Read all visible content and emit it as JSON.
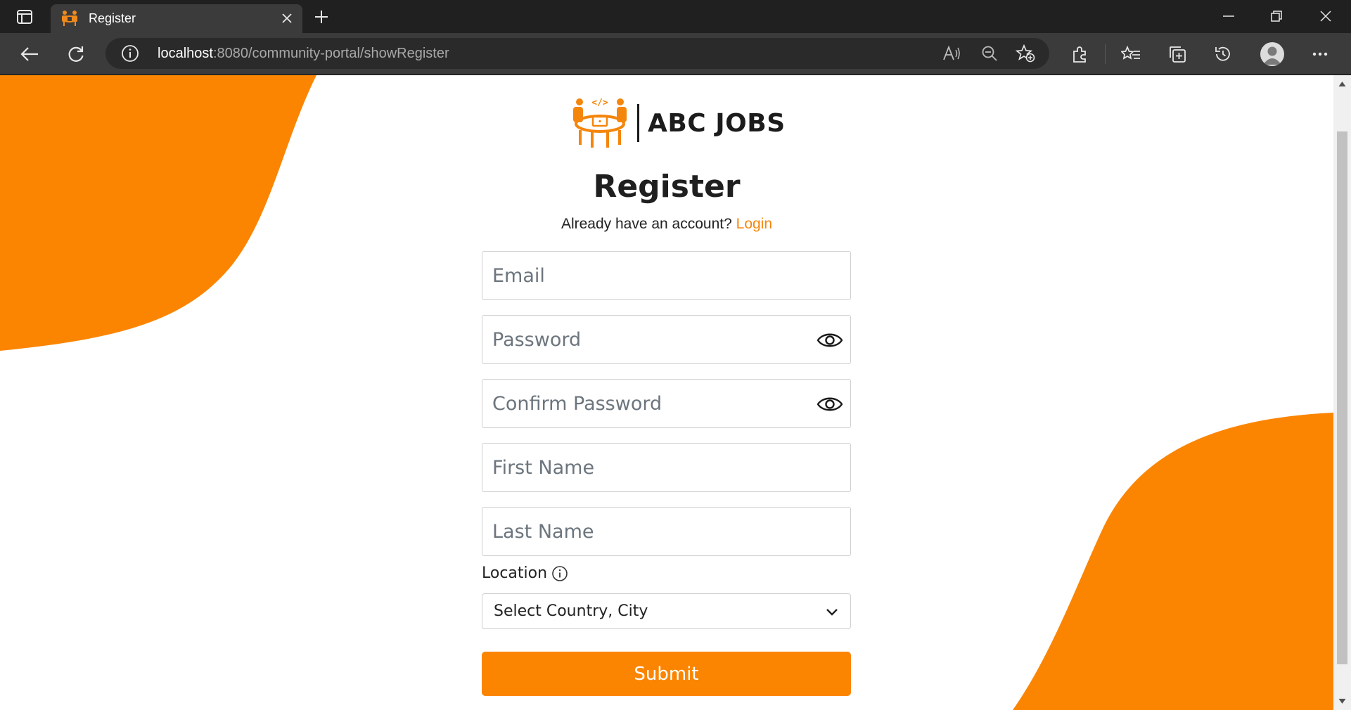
{
  "browser": {
    "tab_title": "Register",
    "url_host": "localhost",
    "url_rest": ":8080/community-portal/showRegister"
  },
  "page": {
    "logo_text": "ABC JOBS",
    "title": "Register",
    "login_prompt": "Already have an account?",
    "login_link": "Login",
    "fields": {
      "email_placeholder": "Email",
      "password_placeholder": "Password",
      "confirm_password_placeholder": "Confirm Password",
      "first_name_placeholder": "First Name",
      "last_name_placeholder": "Last Name"
    },
    "location_label": "Location",
    "location_select_value": "Select Country, City",
    "submit_label": "Submit"
  },
  "colors": {
    "brand_orange": "#fb8500",
    "link_orange": "#f4860c"
  }
}
